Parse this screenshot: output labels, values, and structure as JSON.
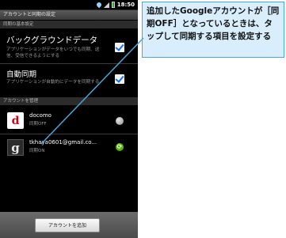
{
  "status_bar": {
    "time": "18:50"
  },
  "title_bar": {
    "title": "アカウントと同期の設定"
  },
  "sync_basic_section": {
    "header": "同期の基本設定"
  },
  "background_data": {
    "title": "バックグラウンドデータ",
    "description": "アプリケーションがデータをいつでも同期、送信、受信できるようにする",
    "checked": true
  },
  "auto_sync": {
    "title": "自動同期",
    "description": "アプリケーションが自動的にデータを同期する",
    "checked": true
  },
  "accounts_section": {
    "header": "アカウントを管理"
  },
  "accounts": [
    {
      "icon": "docomo-logo-icon",
      "icon_letter": "d",
      "name": "docomo",
      "status": "同期OFF",
      "sync_icon": "sync-off-icon"
    },
    {
      "icon": "google-logo-icon",
      "icon_letter": "g",
      "name": "tkhaya0601@gmail.co...",
      "status": "同期ON",
      "sync_icon": "sync-on-icon"
    }
  ],
  "add_account_button": "アカウントを追加",
  "callout": {
    "text": "追加したGoogleアカウントが［同期OFF］となっているときは、タップして同期する項目を設定する"
  },
  "colors": {
    "callout_bg": "#d9eefc",
    "callout_border": "#4aa6d8",
    "docomo_red": "#d7001b",
    "sync_green": "#55b900",
    "checkbox_blue": "#1e6fd6"
  }
}
